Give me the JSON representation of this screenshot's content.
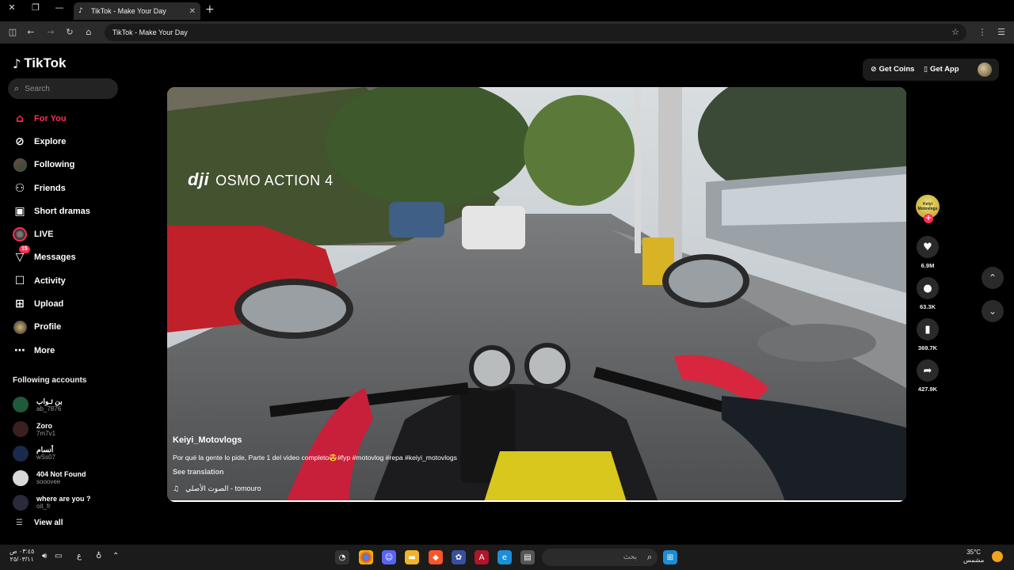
{
  "browser": {
    "tab_title": "TikTok - Make Your Day",
    "address": "TikTok - Make Your Day"
  },
  "sidebar": {
    "logo": "TikTok",
    "search_placeholder": "Search",
    "items": [
      {
        "label": "For You",
        "icon": "home-icon",
        "active": true
      },
      {
        "label": "Explore",
        "icon": "compass-icon"
      },
      {
        "label": "Following",
        "icon": "avatar"
      },
      {
        "label": "Friends",
        "icon": "friends-icon"
      },
      {
        "label": "Short dramas",
        "icon": "film-icon"
      },
      {
        "label": "LIVE",
        "icon": "live-avatar"
      },
      {
        "label": "Messages",
        "icon": "message-icon",
        "badge": "15"
      },
      {
        "label": "Activity",
        "icon": "activity-icon"
      },
      {
        "label": "Upload",
        "icon": "upload-icon"
      },
      {
        "label": "Profile",
        "icon": "avatar"
      },
      {
        "label": "More",
        "icon": "more-icon"
      }
    ],
    "following_heading": "Following accounts",
    "following": [
      {
        "name": "بن ثـواب",
        "handle": "ab_7876",
        "color": "#1f5a3a"
      },
      {
        "name": "Zoro",
        "handle": "7m7v1",
        "color": "#3a2020"
      },
      {
        "name": "أنسام",
        "handle": "wSs07",
        "color": "#1a2a4a"
      },
      {
        "name": "404 Not Found",
        "handle": "sooovee",
        "color": "#d9d9d9"
      },
      {
        "name": "where are you ?",
        "handle": "oit_fr",
        "color": "#2a2a3a"
      }
    ],
    "view_all": "View all"
  },
  "header": {
    "get_coins": "Get Coins",
    "get_app": "Get App"
  },
  "video": {
    "watermark_brand": "dji",
    "watermark_text": "OSMO ACTION 4",
    "username": "Keiyi_Motovlogs",
    "caption": "Por qué la gente lo pide, Parte 1 del video completo😍#fyp #motovlog #repa #keiyi_motovlogs",
    "see_translation": "See translation",
    "music": "الصوت الأصلي - tomouro",
    "progress": 0.995
  },
  "actions": {
    "creator_avatar_text": "Keiyi Motovlogs",
    "likes": "6.9M",
    "comments": "63.3K",
    "saves": "369.7K",
    "shares": "427.9K"
  },
  "taskbar": {
    "time": "٠٣:٤٥ ص",
    "date": "٢٥/٠٣/١١",
    "lang": "ع",
    "search_label": "بحث",
    "temperature": "35°C",
    "weather": "مشمس"
  }
}
